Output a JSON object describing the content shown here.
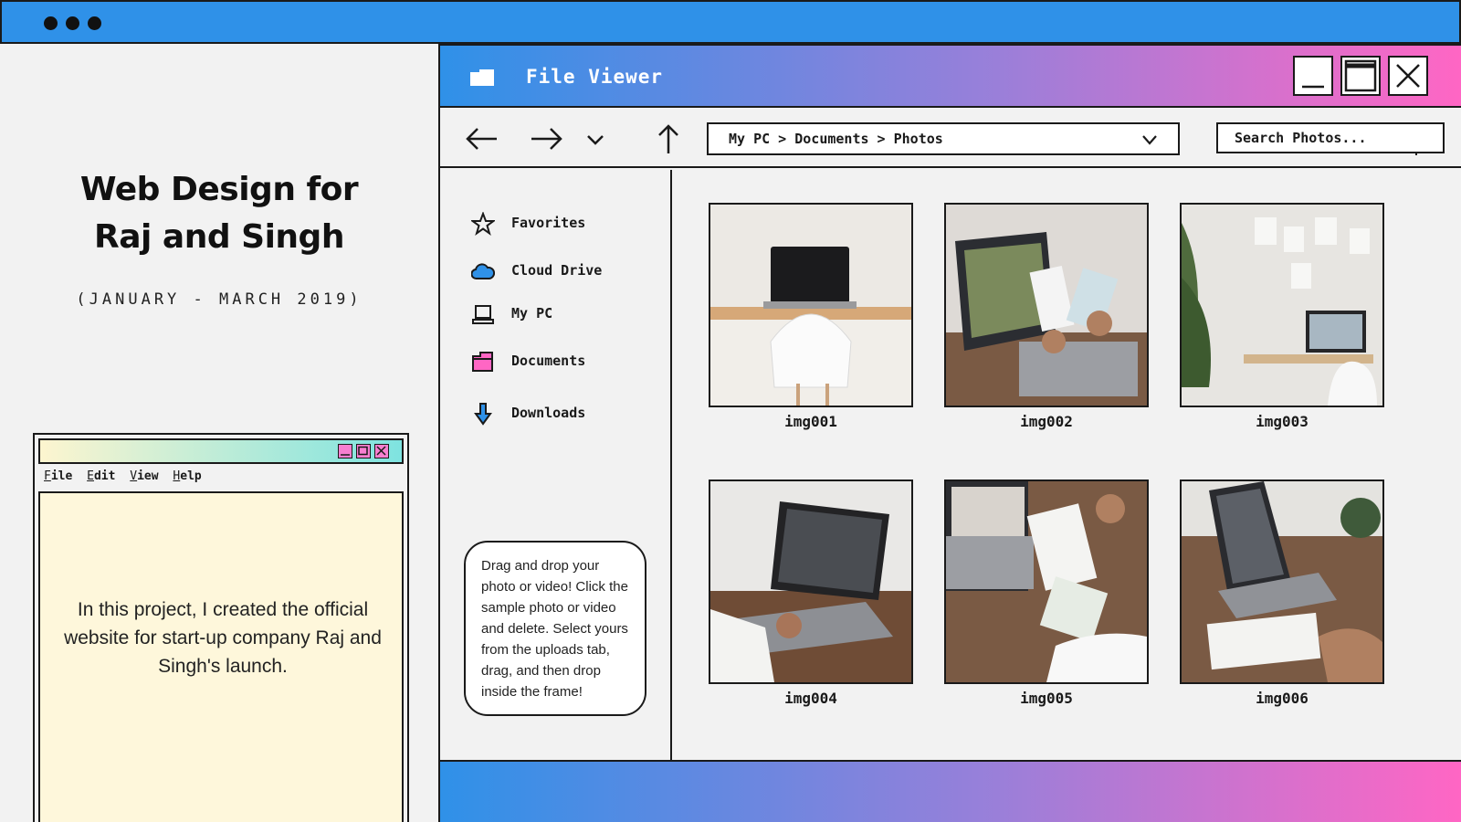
{
  "hero": {
    "title_line1": "Web Design for",
    "title_line2": "Raj and Singh",
    "subtitle": "(JANUARY - MARCH 2019)"
  },
  "notepad": {
    "menu": [
      {
        "key": "F",
        "rest": "ile"
      },
      {
        "key": "E",
        "rest": "dit"
      },
      {
        "key": "V",
        "rest": "iew"
      },
      {
        "key": "H",
        "rest": "elp"
      }
    ],
    "body_text": "In this project, I created the official website for start-up company Raj and Singh's launch."
  },
  "file_viewer": {
    "title": "File Viewer",
    "address": "My PC > Documents > Photos",
    "search_placeholder": "Search Photos...",
    "sidebar": [
      {
        "label": "Favorites",
        "icon": "star-icon"
      },
      {
        "label": "Cloud Drive",
        "icon": "cloud-icon"
      },
      {
        "label": "My PC",
        "icon": "laptop-icon"
      },
      {
        "label": "Documents",
        "icon": "folder-icon"
      },
      {
        "label": "Downloads",
        "icon": "download-arrow-icon"
      }
    ],
    "tip": "Drag and drop your photo or video! Click the sample photo or video and delete. Select yours from the uploads tab, drag, and then drop inside the frame!",
    "files": [
      {
        "name": "img001"
      },
      {
        "name": "img002"
      },
      {
        "name": "img003"
      },
      {
        "name": "img004"
      },
      {
        "name": "img005"
      },
      {
        "name": "img006"
      }
    ]
  },
  "colors": {
    "topbar": "#2f91e8",
    "gradient_start": "#2f91e8",
    "gradient_mid": "#9b7fd9",
    "gradient_end": "#ff66c4",
    "note_bg": "#fef7db"
  }
}
